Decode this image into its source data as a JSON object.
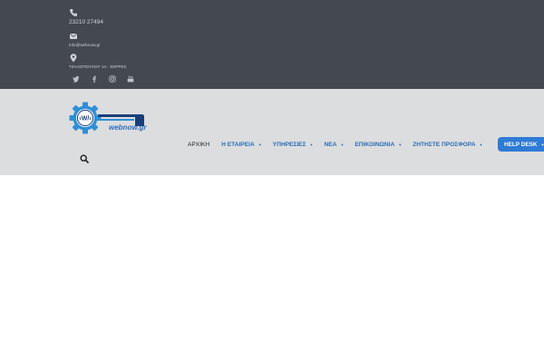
{
  "topbar": {
    "phone": {
      "icon": "phone-icon",
      "text": "23210 27494"
    },
    "email": {
      "icon": "envelope-icon",
      "text": "info@webnow.gr"
    },
    "address": {
      "icon": "map-marker-icon",
      "text": "ΤΣΑΛΟΠΟΥΛΟΥ 14 - ΣΕΡΡΕΣ"
    },
    "social": [
      "twitter-icon",
      "facebook-icon",
      "instagram-icon",
      "youtube-icon"
    ]
  },
  "header": {
    "logo_text": "webnow.gr",
    "nav": [
      {
        "label": "ΑΡΧΙΚΗ",
        "has_dropdown": false
      },
      {
        "label": "Η ΕΤΑΙΡΕΙΑ",
        "has_dropdown": true
      },
      {
        "label": "ΥΠΗΡΕΣΙΕΣ",
        "has_dropdown": true
      },
      {
        "label": "ΝΕΑ",
        "has_dropdown": true
      },
      {
        "label": "ΕΠΙΚΟΙΝΩΝΙΑ",
        "has_dropdown": true
      },
      {
        "label": "ΖΗΤΗΣΤΕ ΠΡΟΣΦΟΡΑ",
        "has_dropdown": true
      }
    ],
    "helpdesk_label": "HELP DESK",
    "search_icon": "search-icon"
  },
  "colors": {
    "topbar_bg": "#444950",
    "header_bg": "#dcdddf",
    "accent": "#2a6db5",
    "helpdesk_bg": "#2f7bd6"
  }
}
